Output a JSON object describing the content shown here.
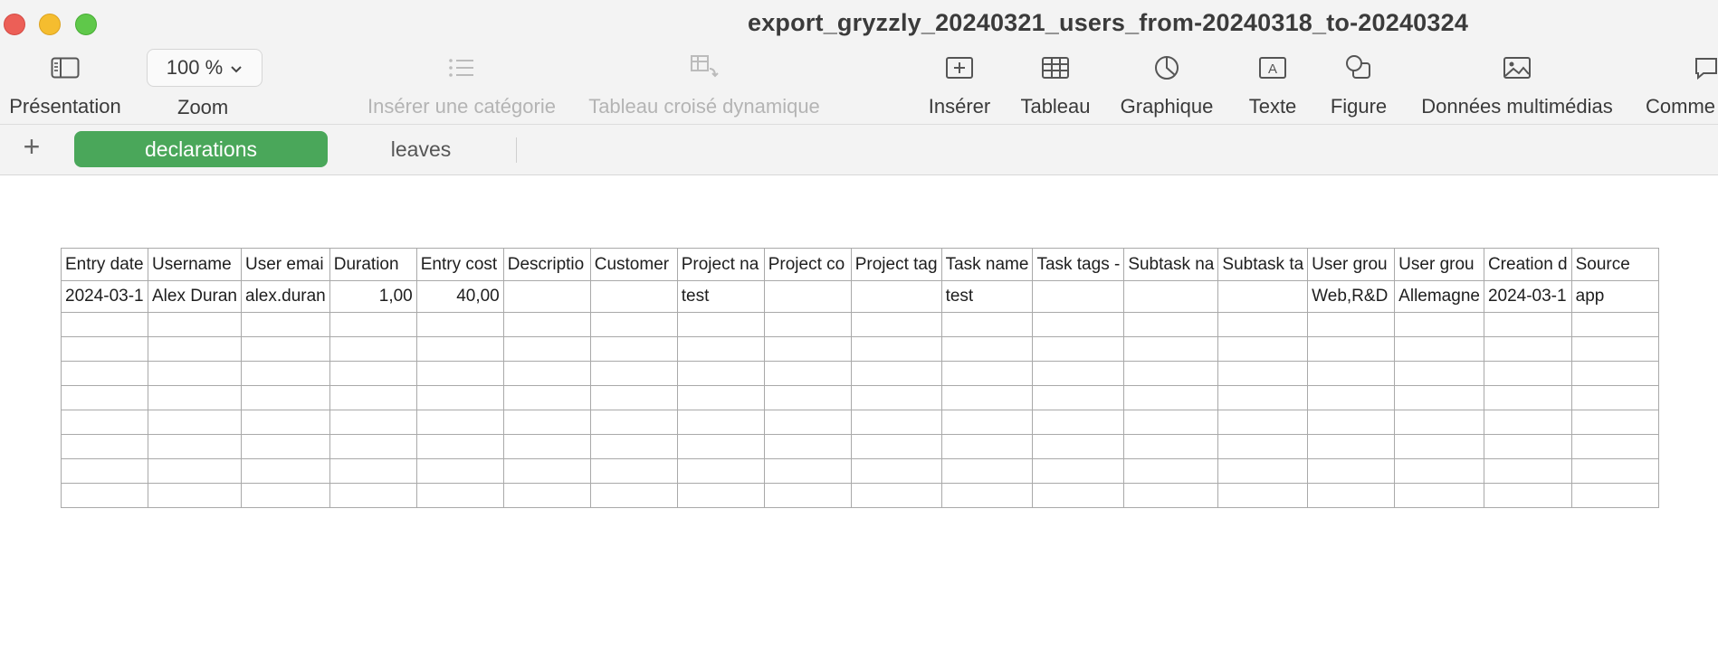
{
  "window": {
    "title": "export_gryzzly_20240321_users_from-20240318_to-20240324"
  },
  "toolbar": {
    "presentation_label": "Présentation",
    "zoom_value": "100 %",
    "zoom_label": "Zoom",
    "insert_category_label": "Insérer une catégorie",
    "pivot_table_label": "Tableau croisé dynamique",
    "insert_label": "Insérer",
    "table_label": "Tableau",
    "chart_label": "Graphique",
    "text_label": "Texte",
    "shape_label": "Figure",
    "media_label": "Données multimédias",
    "comment_label": "Comme"
  },
  "sheets": {
    "add": "+",
    "tabs": [
      "declarations",
      "leaves"
    ]
  },
  "table": {
    "headers": [
      "Entry date",
      "Username",
      "User emai",
      "Duration",
      "Entry cost",
      "Descriptio",
      "Customer",
      "Project na",
      "Project co",
      "Project tag",
      "Task name",
      "Task tags -",
      "Subtask na",
      "Subtask ta",
      "User grou",
      "User grou",
      "Creation d",
      "Source"
    ],
    "rows": [
      [
        "2024-03-1",
        "Alex Duran",
        "alex.duran",
        "1,00",
        "40,00",
        "",
        "",
        "test",
        "",
        "",
        "test",
        "",
        "",
        "",
        "Web,R&D",
        "Allemagne",
        "2024-03-1",
        "app"
      ]
    ],
    "empty_rows": 8
  }
}
